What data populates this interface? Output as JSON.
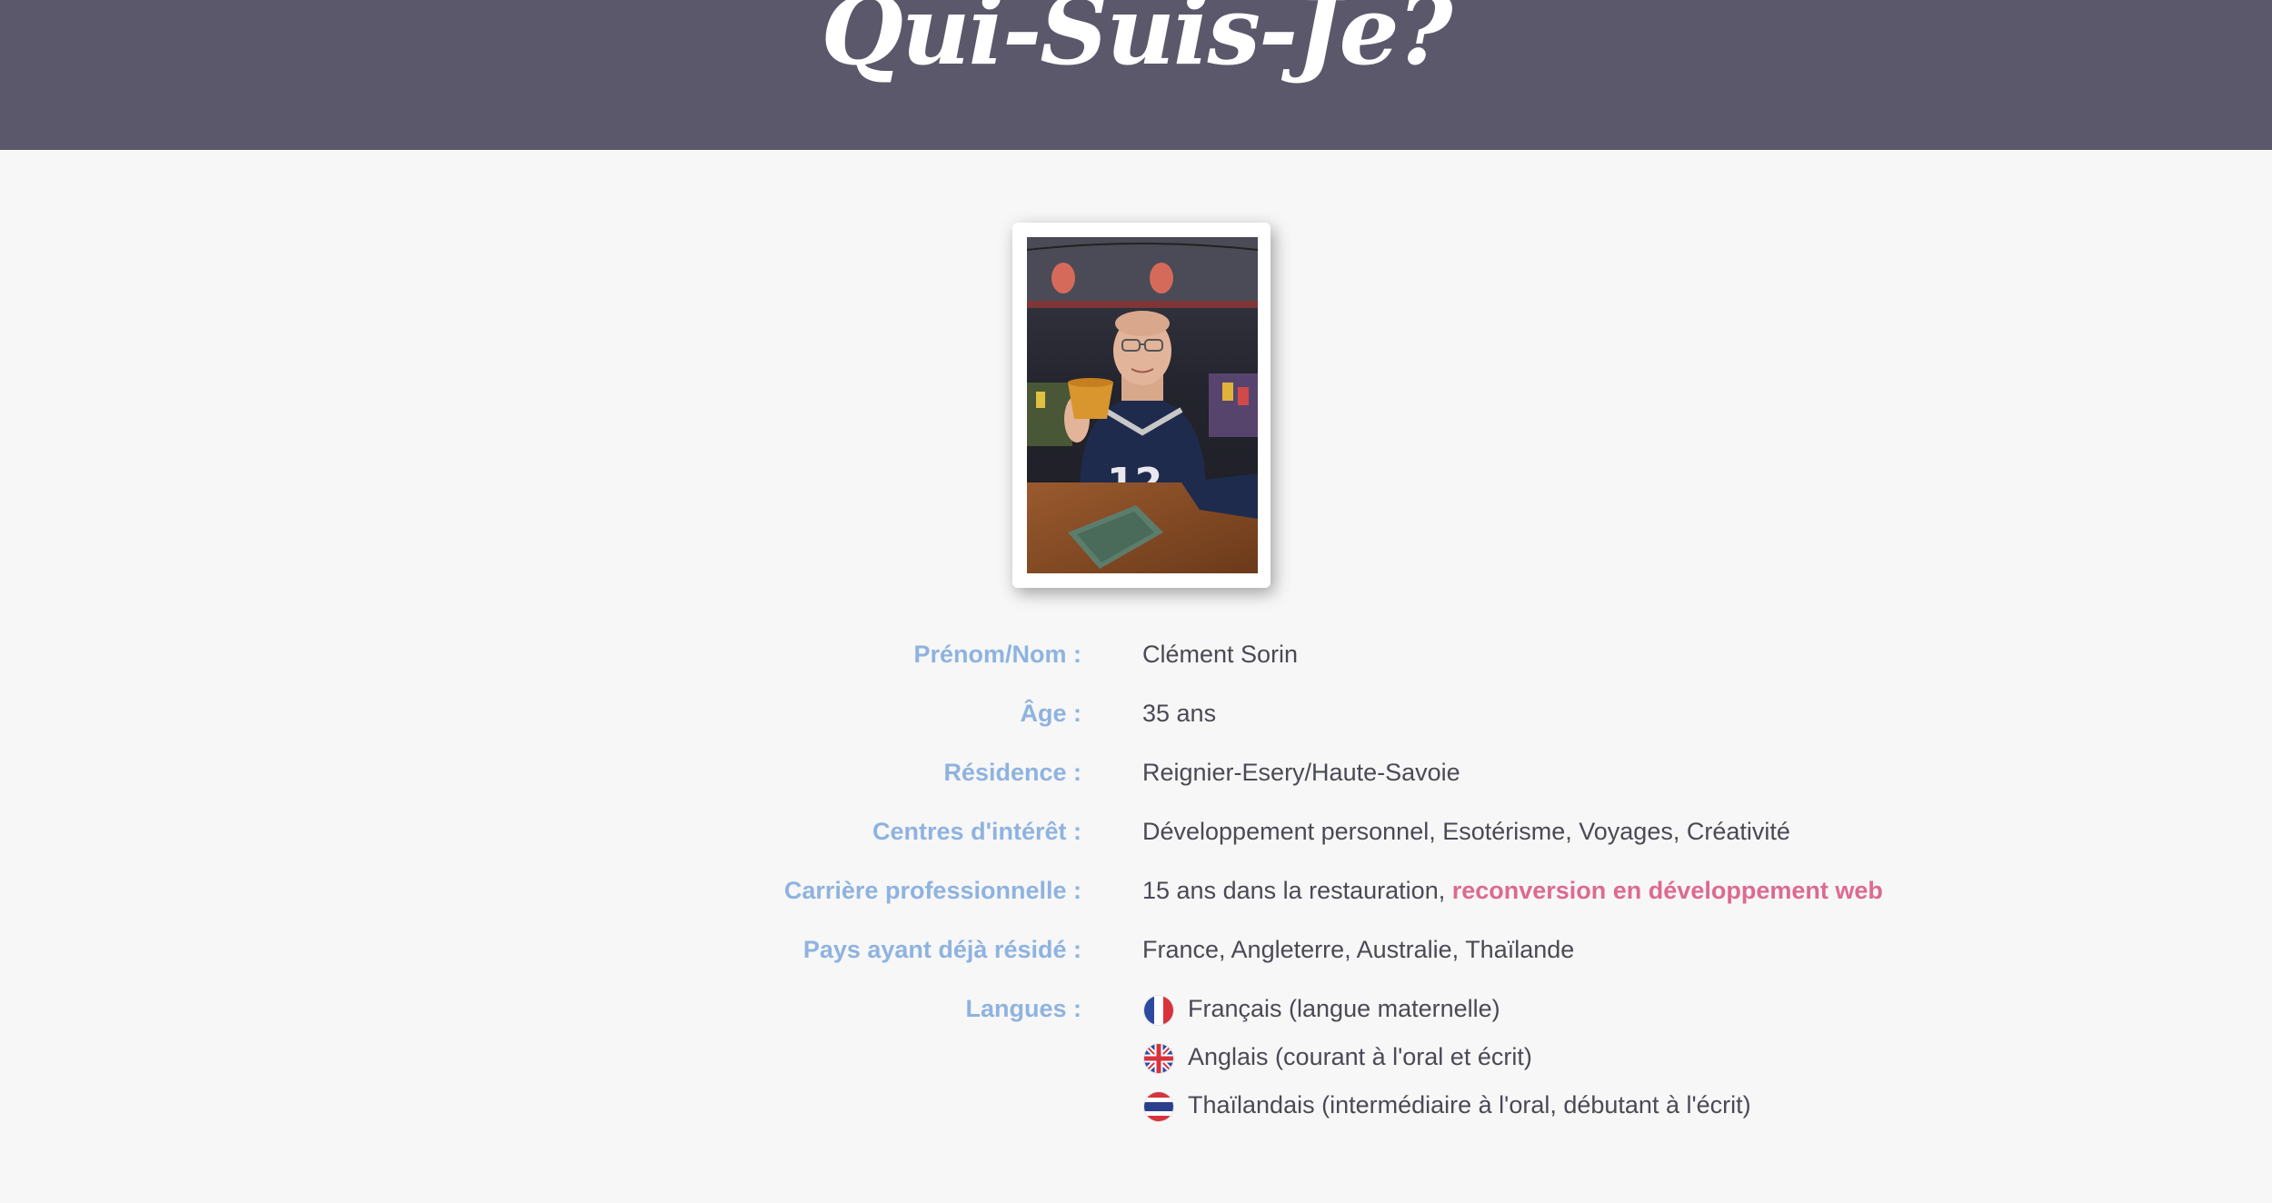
{
  "header": {
    "title": "Qui-Suis-Je?",
    "background_color": "#5c586b"
  },
  "photo": {
    "alt": "Portrait photo"
  },
  "profile": {
    "rows": [
      {
        "label": "Prénom/Nom :",
        "value": "Clément Sorin"
      },
      {
        "label": "Âge :",
        "value": "35 ans"
      },
      {
        "label": "Résidence :",
        "value": "Reignier-Esery/Haute-Savoie"
      },
      {
        "label": "Centres d'intérêt :",
        "value": "Développement personnel, Esotérisme, Voyages, Créativité"
      },
      {
        "label": "Carrière professionnelle :",
        "value": "15 ans dans la restauration, ",
        "highlight": "reconversion en développement web"
      },
      {
        "label": "Pays ayant déjà résidé :",
        "value": "France, Angleterre, Australie, Thaïlande"
      }
    ],
    "languages_label": "Langues :",
    "languages": [
      {
        "flag": "france-flag-icon",
        "text": "Français (langue maternelle)"
      },
      {
        "flag": "uk-flag-icon",
        "text": "Anglais (courant à l'oral et écrit)"
      },
      {
        "flag": "thailand-flag-icon",
        "text": "Thaïlandais (intermédiaire à l'oral, débutant à l'écrit)"
      }
    ]
  },
  "colors": {
    "label": "#8fb3df",
    "text": "#4a4a55",
    "highlight": "#dd6a8f",
    "background": "#f7f7f7"
  }
}
